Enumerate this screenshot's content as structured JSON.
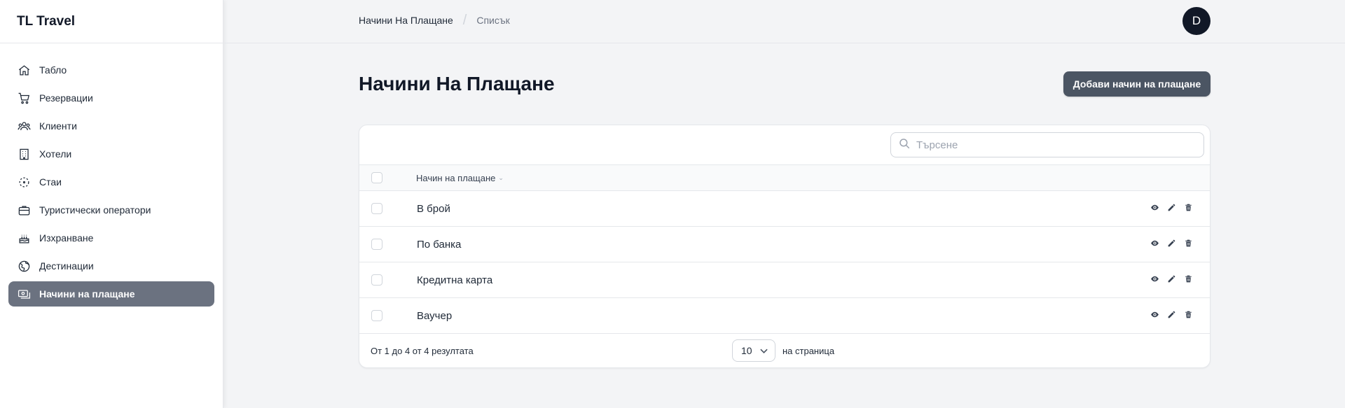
{
  "app": {
    "brand": "TL Travel"
  },
  "sidebar": {
    "items": [
      {
        "label": "Табло",
        "icon": "home-icon",
        "active": false
      },
      {
        "label": "Резервации",
        "icon": "cart-icon",
        "active": false
      },
      {
        "label": "Клиенти",
        "icon": "users-icon",
        "active": false
      },
      {
        "label": "Хотели",
        "icon": "building-icon",
        "active": false
      },
      {
        "label": "Стаи",
        "icon": "dashed-circle-icon",
        "active": false
      },
      {
        "label": "Туристически оператори",
        "icon": "briefcase-icon",
        "active": false
      },
      {
        "label": "Изхранване",
        "icon": "cake-icon",
        "active": false
      },
      {
        "label": "Дестинации",
        "icon": "globe-icon",
        "active": false
      },
      {
        "label": "Начини на плащане",
        "icon": "cash-icon",
        "active": true
      }
    ]
  },
  "topbar": {
    "breadcrumb": [
      "Начини На Плащане",
      "Списък"
    ],
    "avatar_initial": "D"
  },
  "page": {
    "title": "Начини На Плащане",
    "add_button": "Добави начин на плащане"
  },
  "table": {
    "search_placeholder": "Търсене",
    "column_header": "Начин на плащане",
    "rows": [
      {
        "name": "В брой"
      },
      {
        "name": "По банка"
      },
      {
        "name": "Кредитна карта"
      },
      {
        "name": "Ваучер"
      }
    ],
    "footer": {
      "summary": "От 1 до 4 от 4 резултата",
      "per_page_value": "10",
      "per_page_label": "на страница"
    }
  },
  "colors": {
    "active_nav_bg": "#6b7280",
    "primary_button": "#4b5563",
    "avatar_bg": "#111827",
    "page_bg": "#f3f4f6"
  }
}
